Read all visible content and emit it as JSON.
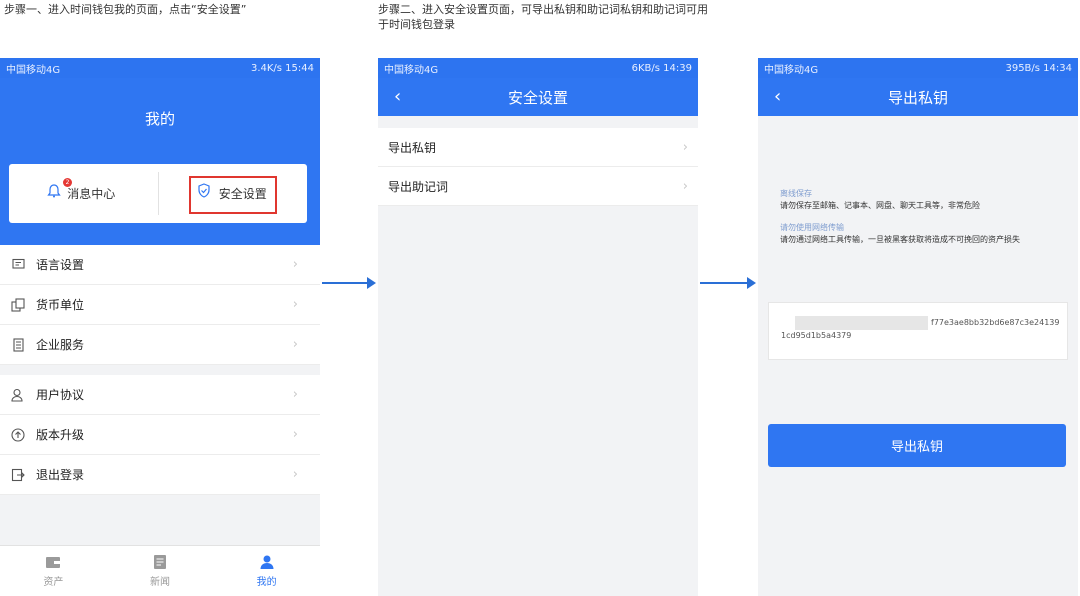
{
  "captions": {
    "step1": "步骤一、进入时间钱包我的页面，点击“安全设置”",
    "step2": "步骤二、进入安全设置页面，可导出私钥和助记词私钥和助记词可用于时间钱包登录"
  },
  "phone1": {
    "status_left": "中国移动4G",
    "status_right": "3.4K/s  15:44",
    "title": "我的",
    "card": {
      "messages": "消息中心",
      "security": "安全设置",
      "badge": "2"
    },
    "menu": [
      {
        "label": "语言设置",
        "icon": "chat-icon"
      },
      {
        "label": "货币单位",
        "icon": "currency-icon"
      },
      {
        "label": "企业服务",
        "icon": "building-icon"
      },
      {
        "label": "用户协议",
        "icon": "user-doc-icon"
      },
      {
        "label": "版本升级",
        "icon": "upgrade-icon"
      },
      {
        "label": "退出登录",
        "icon": "logout-icon"
      }
    ],
    "tabs": [
      {
        "label": "资产"
      },
      {
        "label": "新闻"
      },
      {
        "label": "我的"
      }
    ]
  },
  "phone2": {
    "status_left": "中国移动4G",
    "status_right": "6KB/s  14:39",
    "title": "安全设置",
    "rows": [
      {
        "label": "导出私钥"
      },
      {
        "label": "导出助记词"
      }
    ]
  },
  "phone3": {
    "status_left": "中国移动4G",
    "status_right": "395B/s  14:34",
    "title": "导出私钥",
    "tip1_title": "离线保存",
    "tip1_text": "请勿保存至邮箱、记事本、网盘、聊天工具等，非常危险",
    "tip2_title": "请勿使用网络传输",
    "tip2_text": "请勿通过网络工具传输，一旦被黑客获取将造成不可挽回的资产损失",
    "key_line1": "f77e3ae8bb32bd6e87c3e24139",
    "key_line2": "1cd95d1b5a4379",
    "button": "导出私钥"
  },
  "colors": {
    "brand": "#2f76f2",
    "highlight": "#e0362f"
  }
}
